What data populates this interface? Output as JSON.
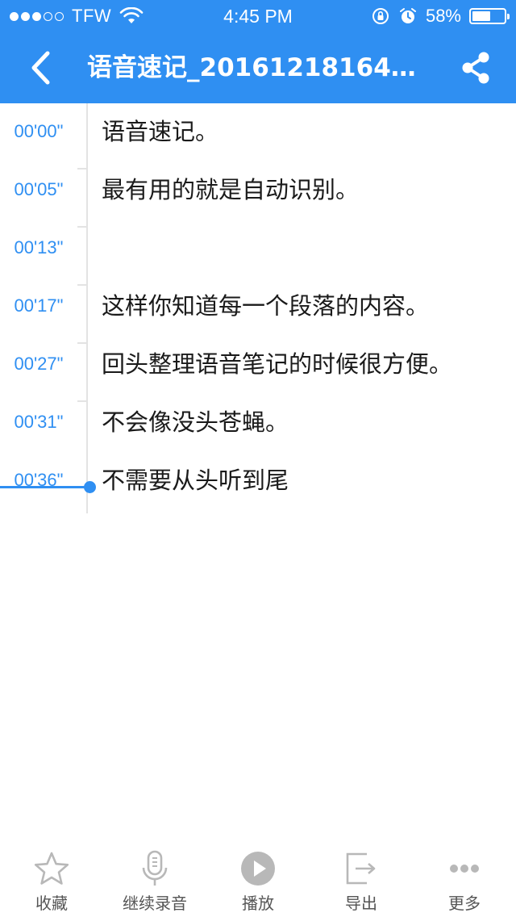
{
  "status_bar": {
    "carrier": "TFW",
    "time": "4:45 PM",
    "battery": "58%",
    "battery_level": 0.58
  },
  "nav": {
    "title": "语音速记_201612181641..."
  },
  "transcript": [
    {
      "time": "00'00\"",
      "text": "语音速记。"
    },
    {
      "time": "00'05\"",
      "text": "最有用的就是自动识别。"
    },
    {
      "time": "00'13\"",
      "text": ""
    },
    {
      "time": "00'17\"",
      "text": "这样你知道每一个段落的内容。"
    },
    {
      "time": "00'27\"",
      "text": "回头整理语音笔记的时候很方便。"
    },
    {
      "time": "00'31\"",
      "text": "不会像没头苍蝇。"
    },
    {
      "time": "00'36\"",
      "text": "不需要从头听到尾"
    }
  ],
  "toolbar": {
    "favorite": "收藏",
    "continue_record": "继续录音",
    "play": "播放",
    "export": "导出",
    "more": "更多"
  },
  "colors": {
    "accent": "#2f8ff2",
    "icon_gray": "#b8b8b8",
    "text": "#1a1a1a"
  }
}
